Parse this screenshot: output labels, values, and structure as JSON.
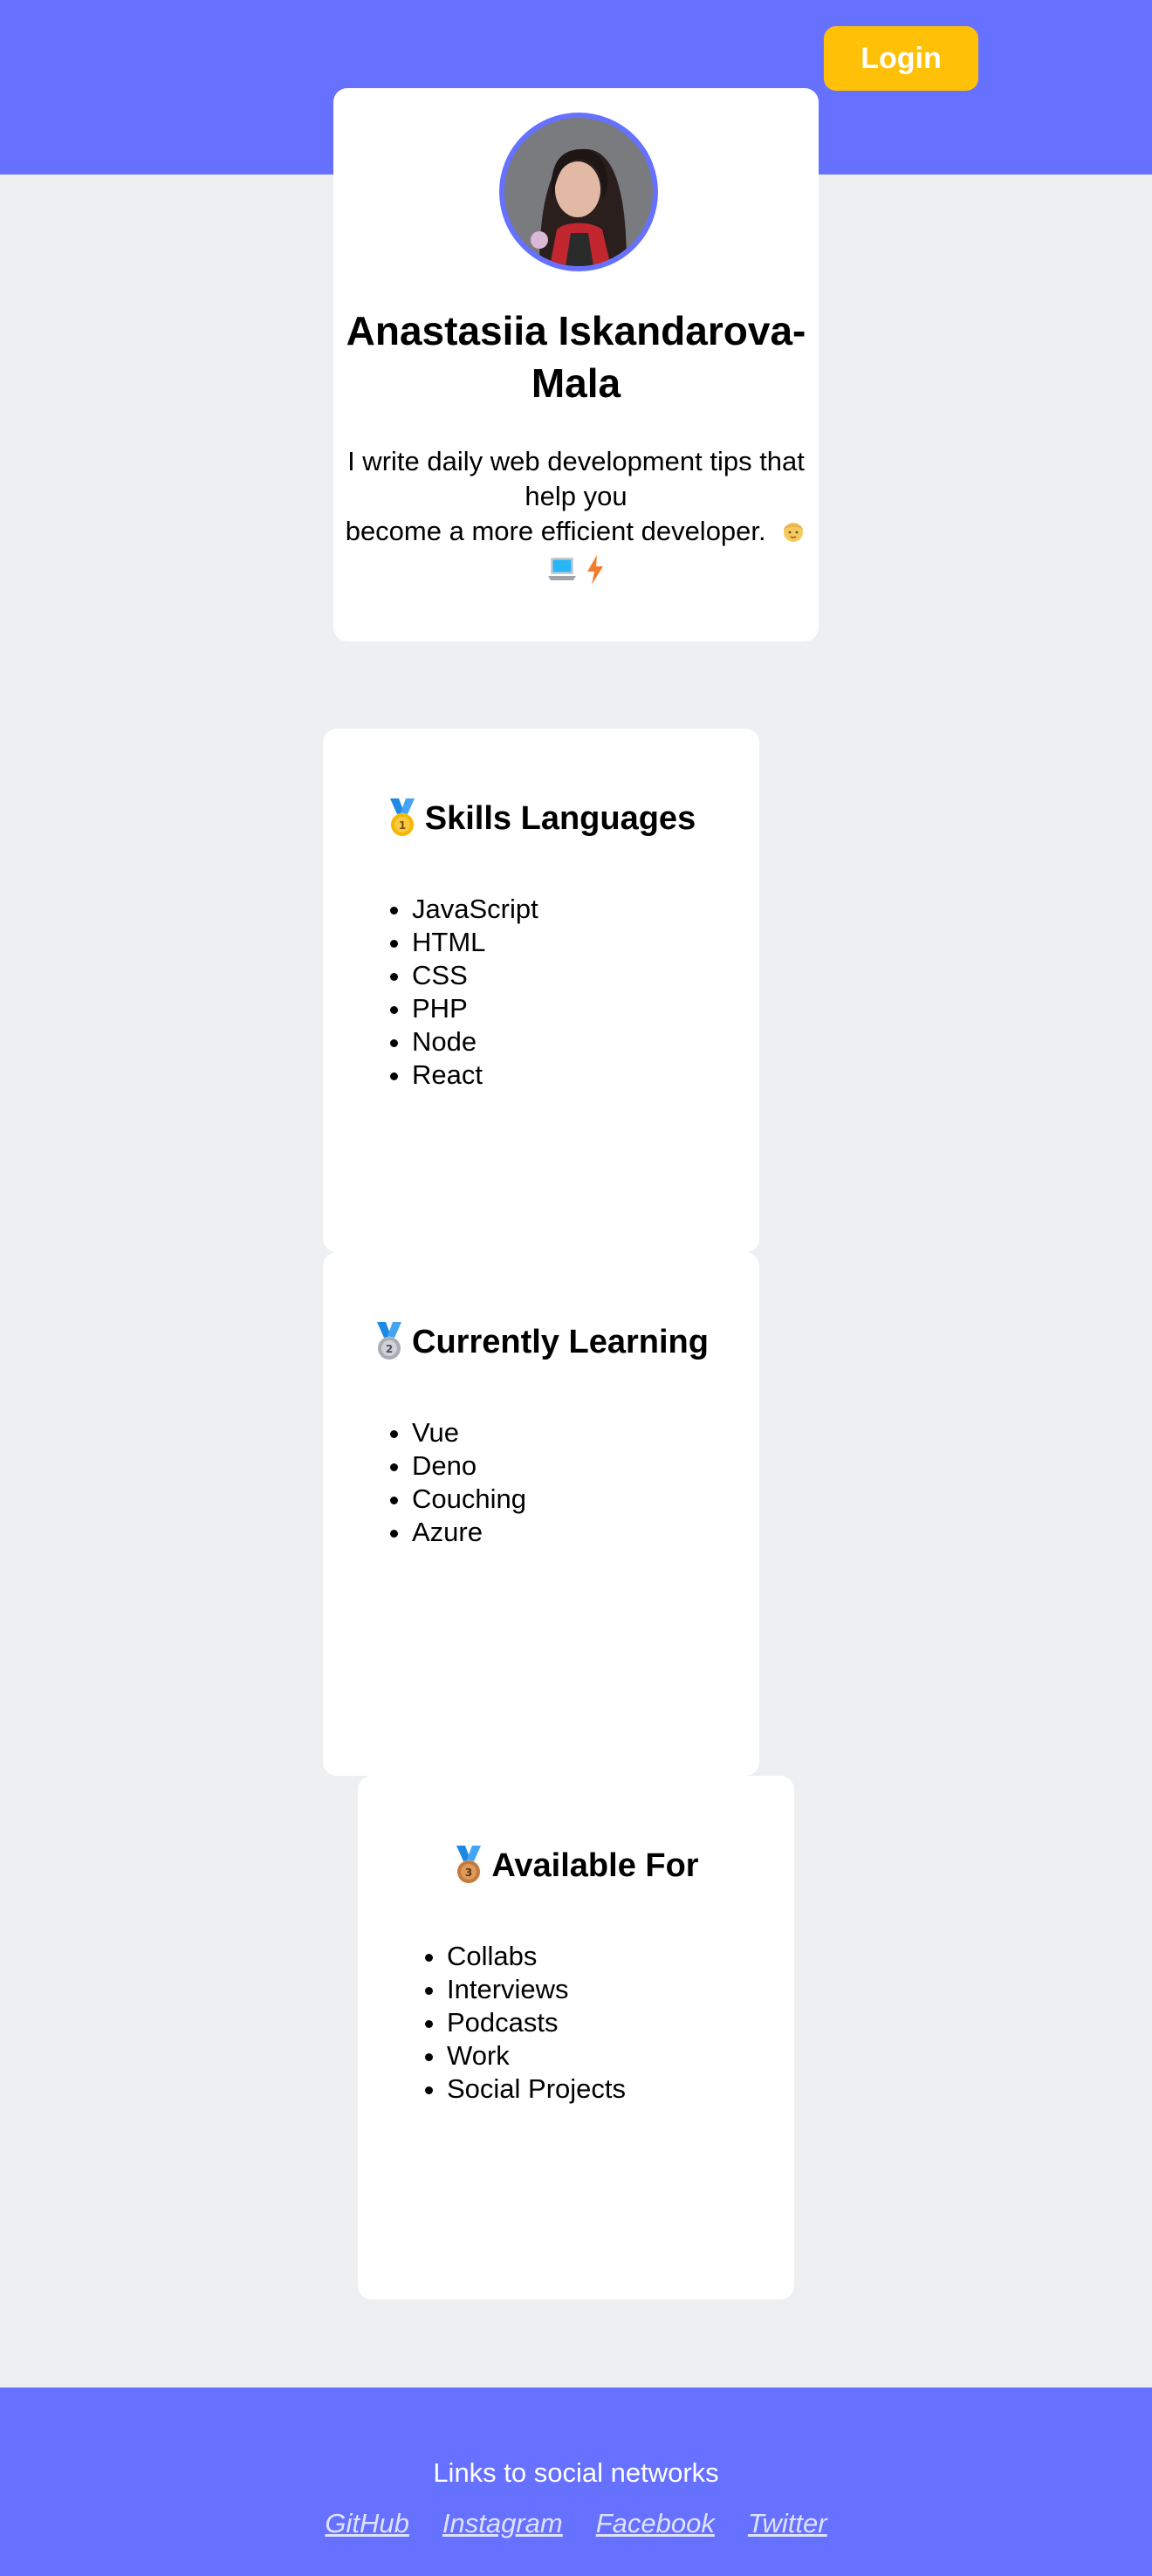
{
  "header": {
    "login_label": "Login",
    "band_color": "#6672ff",
    "login_color": "#ffc107"
  },
  "profile": {
    "name": "Anastasiia Iskandarova-Mala",
    "bio_line1": "I write daily web development tips that help you",
    "bio_line2": "become a more efficient developer.",
    "emojis": [
      "face-icon",
      "laptop-icon",
      "lightning-icon"
    ]
  },
  "cards": [
    {
      "medal": "first-place-medal-icon",
      "title": "Skills Languages",
      "items": [
        "JavaScript",
        "HTML",
        "CSS",
        "PHP",
        "Node",
        "React"
      ]
    },
    {
      "medal": "second-place-medal-icon",
      "title": "Currently Learning",
      "items": [
        "Vue",
        "Deno",
        "Couching",
        "Azure"
      ]
    },
    {
      "medal": "third-place-medal-icon",
      "title": "Available For",
      "items": [
        "Collabs",
        "Interviews",
        "Podcasts",
        "Work",
        "Social Projects"
      ]
    }
  ],
  "footer": {
    "title": "Links to social networks",
    "links": [
      "GitHub",
      "Instagram",
      "Facebook",
      "Twitter"
    ]
  }
}
